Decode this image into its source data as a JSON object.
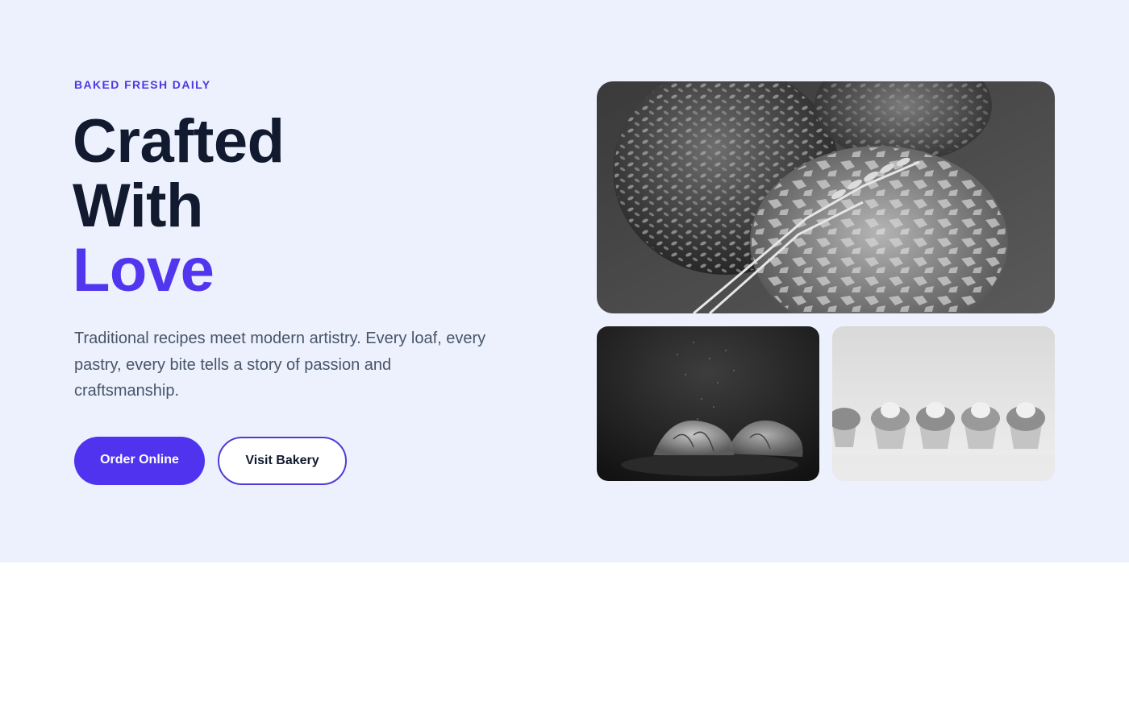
{
  "hero": {
    "eyebrow": "BAKED FRESH DAILY",
    "headline_line1": "Crafted",
    "headline_line2": "With",
    "headline_accent": "Love",
    "description": "Traditional recipes meet modern artistry. Every loaf, every pastry, every bite tells a story of passion and craftsmanship.",
    "primary_button": "Order Online",
    "secondary_button": "Visit Bakery"
  },
  "gallery": {
    "images": [
      {
        "subject": "seeded-bread-loaves-photo"
      },
      {
        "subject": "croissants-photo"
      },
      {
        "subject": "cupcakes-photo"
      }
    ]
  },
  "colors": {
    "hero_background": "#edf1fd",
    "accent": "#4f33ee",
    "heading": "#111a2e",
    "body_text": "#475569"
  }
}
